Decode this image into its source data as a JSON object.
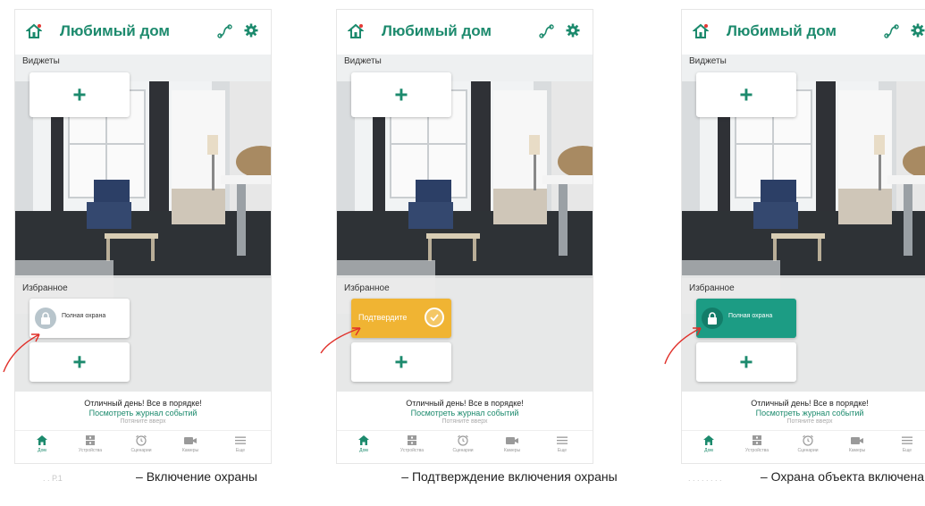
{
  "panels": [
    {
      "title": "Любимый дом",
      "widgets_label": "Виджеты",
      "fav_label": "Избранное",
      "fav_card_text": "Полная охрана",
      "state": "disarmed"
    },
    {
      "title": "Любимый дом",
      "widgets_label": "Виджеты",
      "fav_label": "Избранное",
      "fav_card_text": "Подтвердите",
      "state": "confirm"
    },
    {
      "title": "Любимый дом",
      "widgets_label": "Виджеты",
      "fav_label": "Избранное",
      "fav_card_text": "Полная охрана",
      "state": "armed"
    }
  ],
  "status": {
    "line1": "Отличный день! Все в порядке!",
    "line2": "Посмотреть журнал событий",
    "line3": "Потяните вверх"
  },
  "nav": [
    {
      "label": "Дом",
      "icon": "home-icon",
      "active": true
    },
    {
      "label": "Устройства",
      "icon": "devices-icon",
      "active": false
    },
    {
      "label": "Сценарии",
      "icon": "alarm-clock-icon",
      "active": false
    },
    {
      "label": "Камеры",
      "icon": "camera-icon",
      "active": false
    },
    {
      "label": "Еще",
      "icon": "menu-icon",
      "active": false
    }
  ],
  "captions": [
    "– Включение охраны",
    "– Подтверждение включения охраны",
    "– Охрана объекта включена"
  ],
  "colors": {
    "accent": "#1c8a6d",
    "confirm": "#f0b433",
    "armed": "#1c9c84",
    "arrow": "#e0302a"
  }
}
